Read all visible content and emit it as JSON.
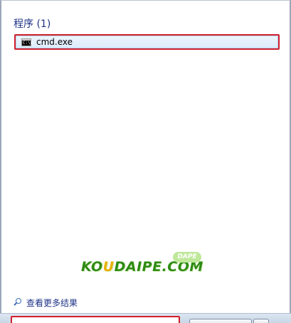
{
  "results": {
    "header": "程序 (1)",
    "items": [
      {
        "label": "cmd.exe",
        "icon": "command-prompt-icon",
        "icon_text": "C:\\>"
      }
    ]
  },
  "watermark": {
    "text_before": "KO",
    "text_highlight": "U",
    "text_after": "DAIPE.COM",
    "badge": "DAPE",
    "colors": {
      "main": "#2e8b12",
      "highlight": "#e8b000",
      "badge": "#bfe89a"
    }
  },
  "footer": {
    "see_more_label": "查看更多结果",
    "icon": "search-icon"
  },
  "search": {
    "value": "",
    "placeholder": ""
  },
  "colors": {
    "header_text": "#1e3287",
    "highlight_border": "#d21f2c",
    "selection_bg": "#dcebfc"
  }
}
